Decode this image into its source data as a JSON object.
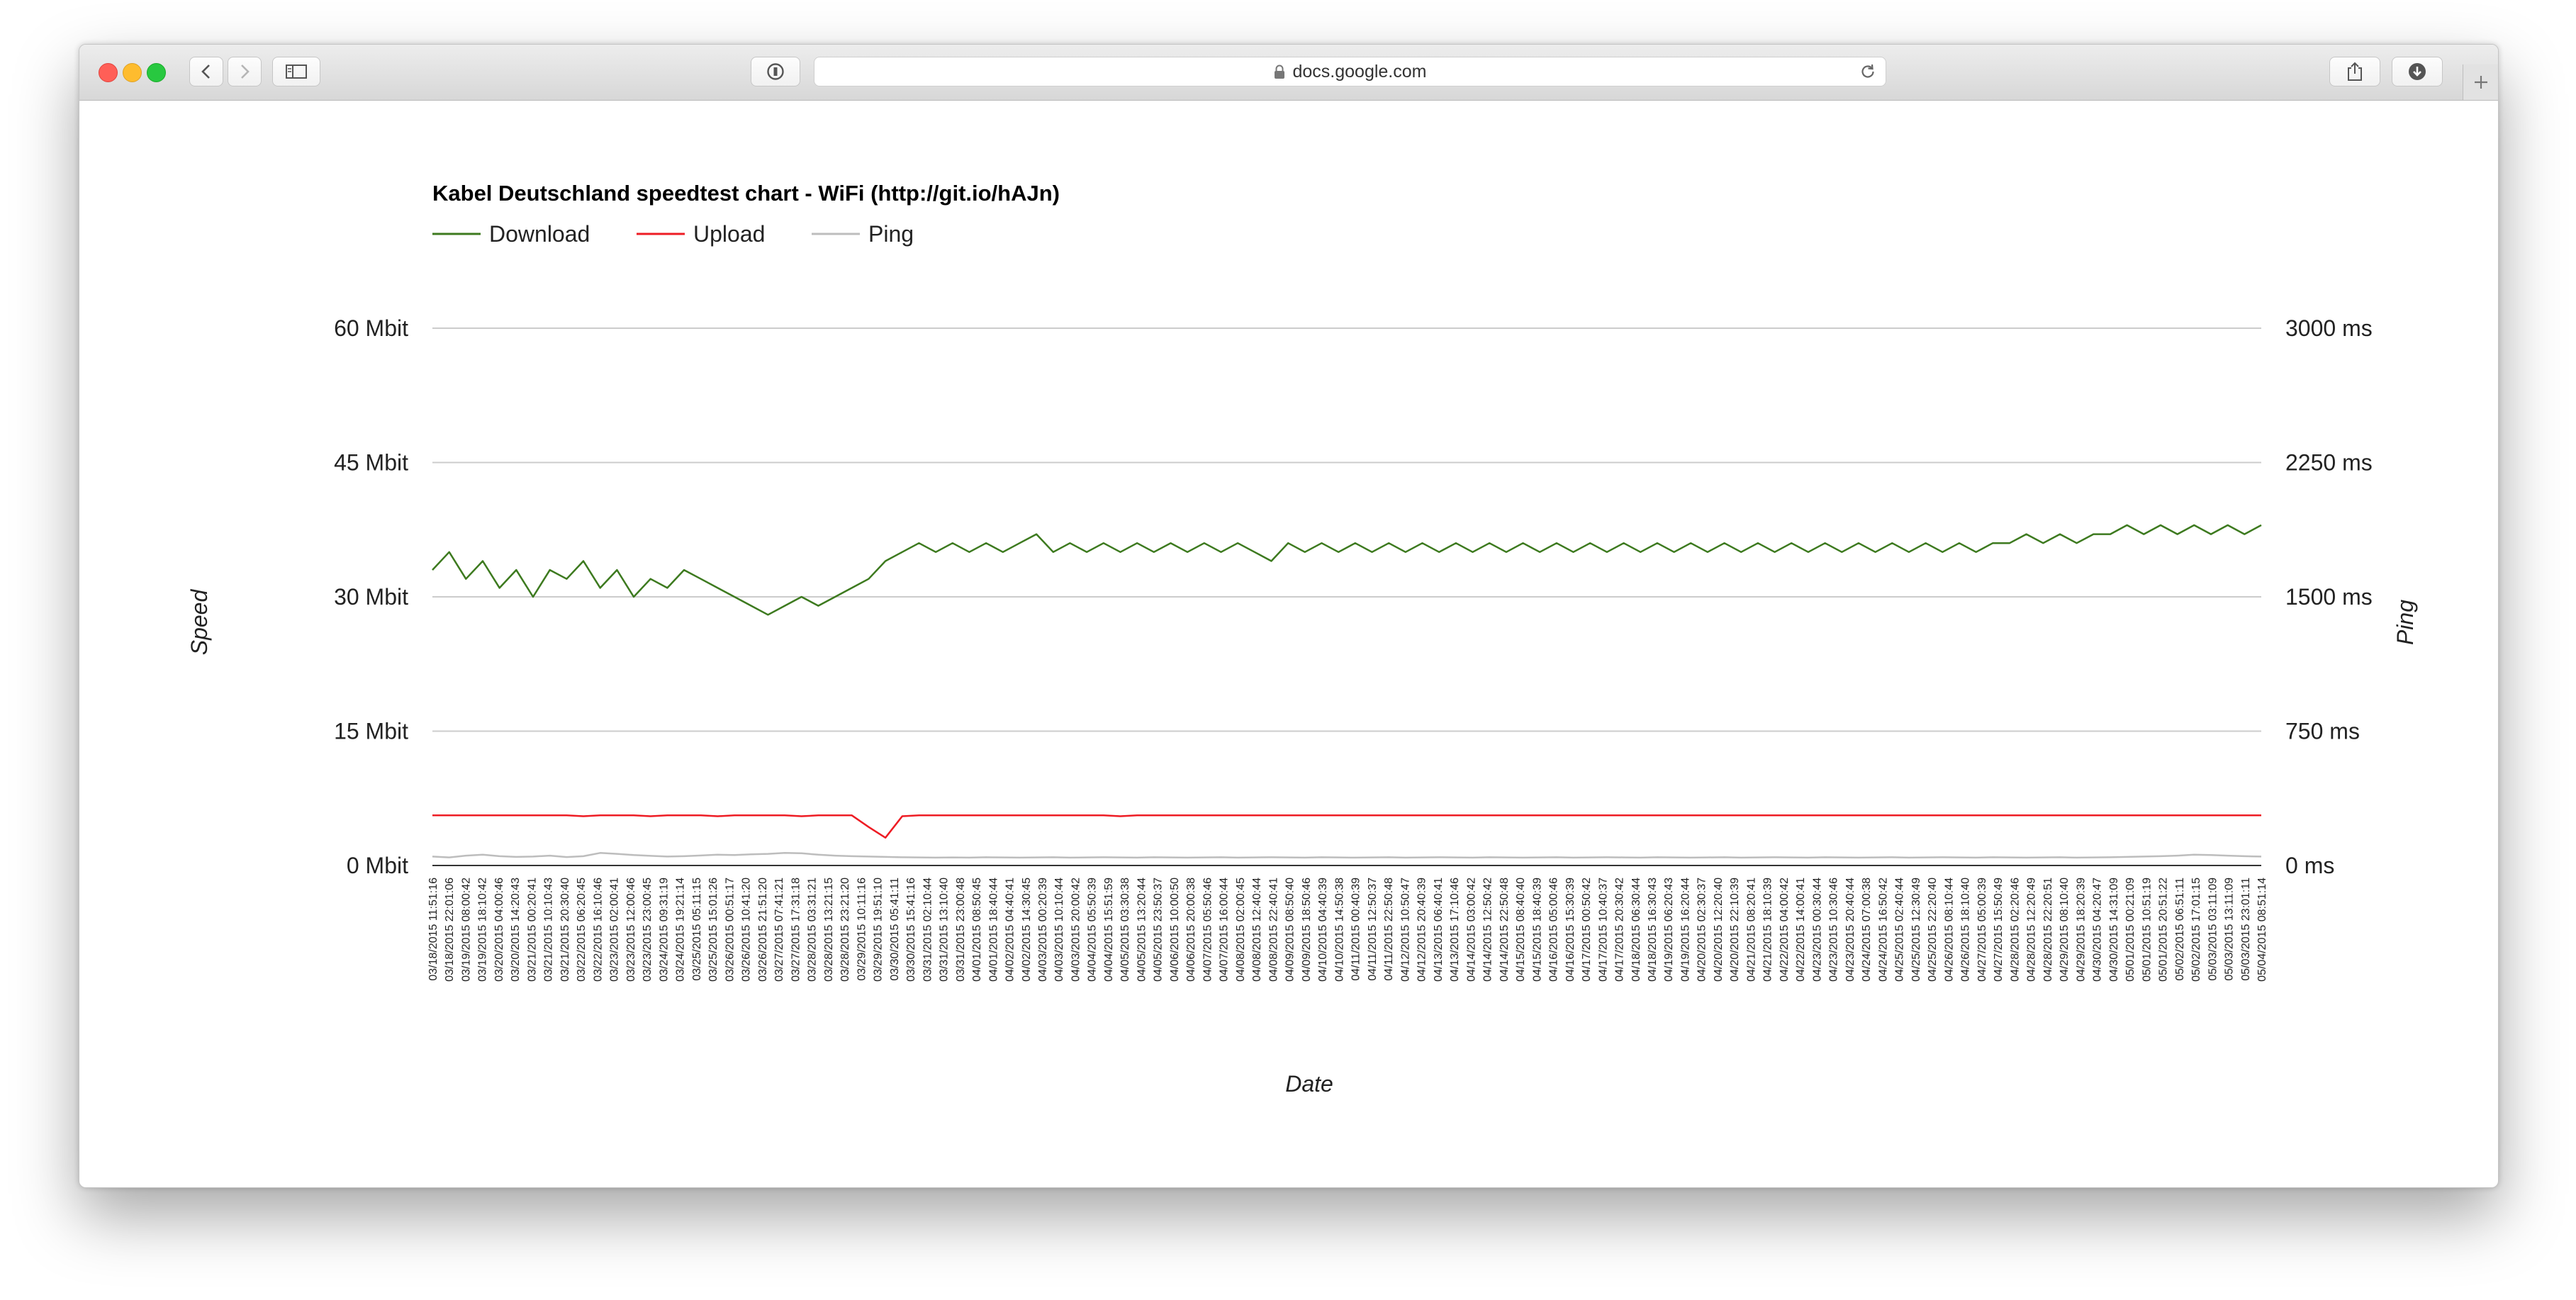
{
  "browser": {
    "url": "docs.google.com",
    "icons": {
      "back": "chevron-left-icon",
      "forward": "chevron-right-icon",
      "sidebar": "sidebar-icon",
      "reader": "reader-icon",
      "lock": "lock-icon",
      "reload": "reload-icon",
      "share": "share-icon",
      "download": "download-icon",
      "new_tab": "plus-icon"
    },
    "colors": {
      "close": "#ff5f57",
      "minimize": "#febc2e",
      "zoom": "#28c840"
    }
  },
  "chart_data": {
    "type": "line",
    "title": "Kabel Deutschland speedtest chart - WiFi (http://git.io/hAJn)",
    "xlabel": "Date",
    "ylabel_left": "Speed",
    "ylabel_right": "Ping",
    "left_axis": {
      "ylim": [
        0,
        60
      ],
      "ticks": [
        0,
        15,
        30,
        45,
        60
      ],
      "tick_labels": [
        "0 Mbit",
        "15 Mbit",
        "30 Mbit",
        "45 Mbit",
        "60 Mbit"
      ]
    },
    "right_axis": {
      "ylim": [
        0,
        3000
      ],
      "ticks": [
        0,
        750,
        1500,
        2250,
        3000
      ],
      "tick_labels": [
        "0 ms",
        "750 ms",
        "1500 ms",
        "2250 ms",
        "3000 ms"
      ]
    },
    "grid": true,
    "legend": "top-left",
    "x_categories": [
      "03/18/2015 11:51:16",
      "03/18/2015 22:01:06",
      "03/19/2015 08:00:42",
      "03/19/2015 18:10:42",
      "03/20/2015 04:00:46",
      "03/20/2015 14:20:43",
      "03/21/2015 00:20:41",
      "03/21/2015 10:10:43",
      "03/21/2015 20:30:40",
      "03/22/2015 06:20:45",
      "03/22/2015 16:10:46",
      "03/23/2015 02:00:41",
      "03/23/2015 12:00:46",
      "03/23/2015 23:00:45",
      "03/24/2015 09:31:19",
      "03/24/2015 19:21:14",
      "03/25/2015 05:11:15",
      "03/25/2015 15:01:26",
      "03/26/2015 00:51:17",
      "03/26/2015 10:41:20",
      "03/26/2015 21:51:20",
      "03/27/2015 07:41:21",
      "03/27/2015 17:31:18",
      "03/28/2015 03:31:21",
      "03/28/2015 13:21:15",
      "03/28/2015 23:21:20",
      "03/29/2015 10:11:16",
      "03/29/2015 19:51:10",
      "03/30/2015 05:41:11",
      "03/30/2015 15:41:16",
      "03/31/2015 02:10:44",
      "03/31/2015 13:10:40",
      "03/31/2015 23:00:48",
      "04/01/2015 08:50:45",
      "04/01/2015 18:40:44",
      "04/02/2015 04:40:41",
      "04/02/2015 14:30:45",
      "04/03/2015 00:20:39",
      "04/03/2015 10:10:44",
      "04/03/2015 20:00:42",
      "04/04/2015 05:50:39",
      "04/04/2015 15:51:59",
      "04/05/2015 03:30:38",
      "04/05/2015 13:20:44",
      "04/05/2015 23:50:37",
      "04/06/2015 10:00:50",
      "04/06/2015 20:00:38",
      "04/07/2015 05:50:46",
      "04/07/2015 16:00:44",
      "04/08/2015 02:00:45",
      "04/08/2015 12:40:44",
      "04/08/2015 22:40:41",
      "04/09/2015 08:50:40",
      "04/09/2015 18:50:46",
      "04/10/2015 04:40:39",
      "04/10/2015 14:50:38",
      "04/11/2015 00:40:39",
      "04/11/2015 12:50:37",
      "04/11/2015 22:50:48",
      "04/12/2015 10:50:47",
      "04/12/2015 20:40:39",
      "04/13/2015 06:40:41",
      "04/13/2015 17:10:46",
      "04/14/2015 03:00:42",
      "04/14/2015 12:50:42",
      "04/14/2015 22:50:48",
      "04/15/2015 08:40:40",
      "04/15/2015 18:40:39",
      "04/16/2015 05:00:46",
      "04/16/2015 15:30:39",
      "04/17/2015 00:50:42",
      "04/17/2015 10:40:37",
      "04/17/2015 20:30:42",
      "04/18/2015 06:30:44",
      "04/18/2015 16:30:43",
      "04/19/2015 06:20:43",
      "04/19/2015 16:20:44",
      "04/20/2015 02:30:37",
      "04/20/2015 12:20:40",
      "04/20/2015 22:10:39",
      "04/21/2015 08:20:41",
      "04/21/2015 18:10:39",
      "04/22/2015 04:00:42",
      "04/22/2015 14:00:41",
      "04/23/2015 00:30:44",
      "04/23/2015 10:30:46",
      "04/23/2015 20:40:44",
      "04/24/2015 07:00:38",
      "04/24/2015 16:50:42",
      "04/25/2015 02:40:44",
      "04/25/2015 12:30:49",
      "04/25/2015 22:20:40",
      "04/26/2015 08:10:44",
      "04/26/2015 18:10:40",
      "04/27/2015 05:00:39",
      "04/27/2015 15:50:49",
      "04/28/2015 02:20:46",
      "04/28/2015 12:20:49",
      "04/28/2015 22:20:51",
      "04/29/2015 08:10:40",
      "04/29/2015 18:20:39",
      "04/30/2015 04:20:47",
      "04/30/2015 14:31:09",
      "05/01/2015 00:21:09",
      "05/01/2015 10:51:19",
      "05/01/2015 20:51:22",
      "05/02/2015 06:51:11",
      "05/02/2015 17:01:15",
      "05/03/2015 03:11:09",
      "05/03/2015 13:11:09",
      "05/03/2015 23:01:11",
      "05/04/2015 08:51:14"
    ],
    "series": [
      {
        "name": "Download",
        "axis": "left",
        "color": "#3d7a1f",
        "values": [
          33,
          35,
          32,
          34,
          31,
          33,
          30,
          33,
          32,
          34,
          31,
          33,
          30,
          32,
          31,
          33,
          32,
          31,
          30,
          29,
          28,
          29,
          30,
          29,
          30,
          31,
          32,
          34,
          35,
          36,
          35,
          36,
          35,
          36,
          35,
          36,
          37,
          35,
          36,
          35,
          36,
          35,
          36,
          35,
          36,
          35,
          36,
          35,
          36,
          35,
          34,
          36,
          35,
          36,
          35,
          36,
          35,
          36,
          35,
          36,
          35,
          36,
          35,
          36,
          35,
          36,
          35,
          36,
          35,
          36,
          35,
          36,
          35,
          36,
          35,
          36,
          35,
          36,
          35,
          36,
          35,
          36,
          35,
          36,
          35,
          36,
          35,
          36,
          35,
          36,
          35,
          36,
          35,
          36,
          36,
          37,
          36,
          37,
          36,
          37,
          37,
          38,
          37,
          38,
          37,
          38,
          37,
          38,
          37,
          38
        ]
      },
      {
        "name": "Upload",
        "axis": "left",
        "color": "#ee1c24",
        "values": [
          5.6,
          5.6,
          5.6,
          5.6,
          5.6,
          5.6,
          5.6,
          5.6,
          5.6,
          5.5,
          5.6,
          5.6,
          5.6,
          5.5,
          5.6,
          5.6,
          5.6,
          5.5,
          5.6,
          5.6,
          5.6,
          5.6,
          5.5,
          5.6,
          5.6,
          5.6,
          4.3,
          3.1,
          5.5,
          5.6,
          5.6,
          5.6,
          5.6,
          5.6,
          5.6,
          5.6,
          5.6,
          5.6,
          5.6,
          5.6,
          5.6,
          5.5,
          5.6,
          5.6,
          5.6,
          5.6,
          5.6,
          5.6,
          5.6,
          5.6,
          5.6,
          5.6,
          5.6,
          5.6,
          5.6,
          5.6,
          5.6,
          5.6,
          5.6,
          5.6,
          5.6,
          5.6,
          5.6,
          5.6,
          5.6,
          5.6,
          5.6,
          5.6,
          5.6,
          5.6,
          5.6,
          5.6,
          5.6,
          5.6,
          5.6,
          5.6,
          5.6,
          5.6,
          5.6,
          5.6,
          5.6,
          5.6,
          5.6,
          5.6,
          5.6,
          5.6,
          5.6,
          5.6,
          5.6,
          5.6,
          5.6,
          5.6,
          5.6,
          5.6,
          5.6,
          5.6,
          5.6,
          5.6,
          5.6,
          5.6,
          5.6,
          5.6,
          5.6,
          5.6,
          5.6,
          5.6,
          5.6,
          5.6,
          5.6,
          5.6
        ]
      },
      {
        "name": "Ping",
        "axis": "right",
        "color": "#bdbdbd",
        "values": [
          50,
          45,
          55,
          60,
          52,
          48,
          50,
          55,
          47,
          52,
          70,
          65,
          58,
          54,
          50,
          52,
          56,
          60,
          58,
          62,
          65,
          70,
          68,
          60,
          55,
          52,
          50,
          48,
          46,
          45,
          44,
          45,
          44,
          46,
          45,
          44,
          45,
          46,
          44,
          45,
          46,
          45,
          44,
          46,
          45,
          44,
          45,
          46,
          44,
          45,
          46,
          45,
          44,
          46,
          45,
          44,
          45,
          46,
          44,
          45,
          46,
          45,
          44,
          46,
          45,
          44,
          45,
          46,
          44,
          45,
          46,
          45,
          44,
          46,
          45,
          44,
          45,
          46,
          44,
          45,
          46,
          45,
          44,
          46,
          45,
          44,
          45,
          46,
          44,
          45,
          46,
          45,
          44,
          46,
          45,
          44,
          45,
          46,
          44,
          45,
          46,
          48,
          50,
          52,
          55,
          60,
          58,
          55,
          52,
          50
        ]
      }
    ]
  }
}
